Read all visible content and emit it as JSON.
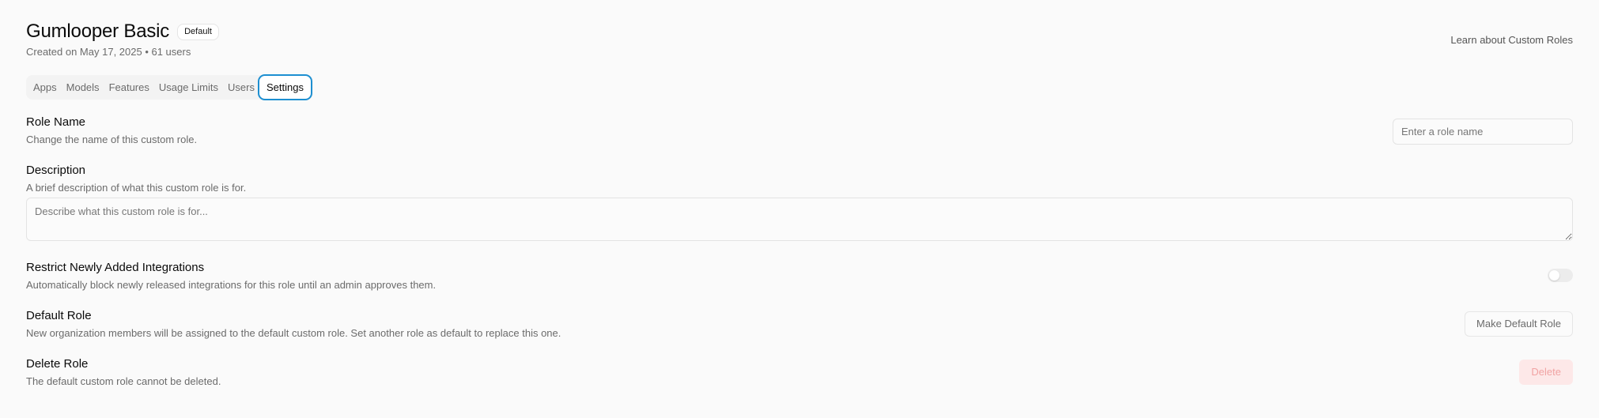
{
  "header": {
    "title": "Gumlooper Basic",
    "badge": "Default",
    "subtitle": "Created on May 17, 2025 • 61 users",
    "learn_link": "Learn about Custom Roles"
  },
  "tabs": [
    {
      "label": "Apps",
      "active": false
    },
    {
      "label": "Models",
      "active": false
    },
    {
      "label": "Features",
      "active": false
    },
    {
      "label": "Usage Limits",
      "active": false
    },
    {
      "label": "Users",
      "active": false
    },
    {
      "label": "Settings",
      "active": true
    }
  ],
  "role_name": {
    "title": "Role Name",
    "description": "Change the name of this custom role.",
    "input_value": "",
    "input_placeholder": "Enter a role name"
  },
  "description": {
    "title": "Description",
    "description": "A brief description of what this custom role is for.",
    "input_value": "",
    "input_placeholder": "Describe what this custom role is for..."
  },
  "restrict": {
    "title": "Restrict Newly Added Integrations",
    "description": "Automatically block newly released integrations for this role until an admin approves them.",
    "toggle_on": false
  },
  "default_role": {
    "title": "Default Role",
    "description": "New organization members will be assigned to the default custom role. Set another role as default to replace this one.",
    "button_label": "Make Default Role"
  },
  "delete_role": {
    "title": "Delete Role",
    "description": "The default custom role cannot be deleted.",
    "button_label": "Delete"
  },
  "colors": {
    "accent_focus": "#1d8fd1",
    "danger_bg": "#fde8e8",
    "danger_text": "#f1a3a3"
  }
}
